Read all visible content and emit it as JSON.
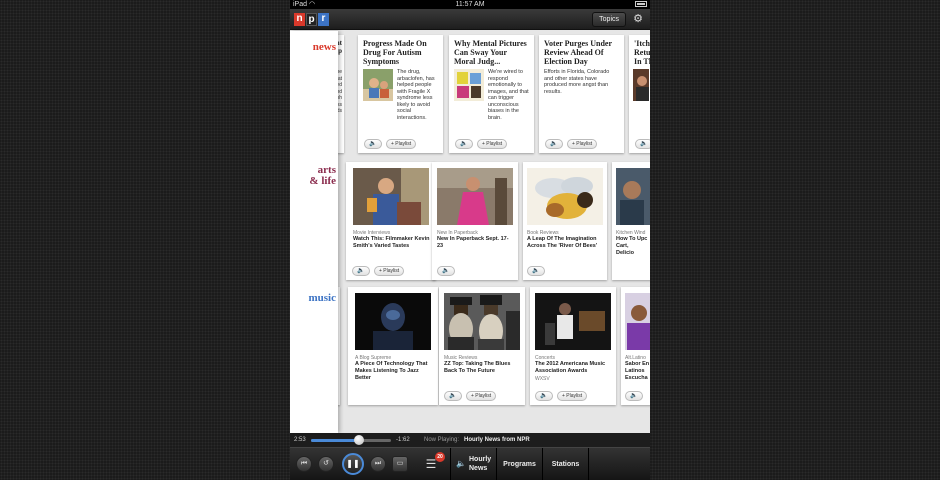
{
  "status_bar": {
    "carrier": "iPad",
    "time": "11:57 AM"
  },
  "nav": {
    "logo_letters": [
      "n",
      "p",
      "r"
    ],
    "topics_label": "Topics"
  },
  "sections": {
    "news": {
      "label": "news",
      "color": "#d9392b",
      "partial_left_lines": [
        "ent",
        "Rop",
        "",
        "n the",
        "that",
        "cted",
        "nd",
        "mph",
        "ness",
        "ds"
      ],
      "stories": [
        {
          "headline": "Progress Made On Drug For Autism Symptoms",
          "body": "The drug, arbaclofen, has helped people with Fragile X syndrome less likely to avoid social interactions.",
          "playlist": "+ Playlist"
        },
        {
          "headline": "Why Mental Pictures Can Sway Your Moral Judg...",
          "body": "We're wired to respond emotionally to images, and that can trigger unconscious biases in the brain.",
          "playlist": "+ Playlist"
        },
        {
          "headline": "Voter Purges Under Review Ahead Of Election Day",
          "body": "Efforts in Florida, Colorado and other states have produced more angst than results.",
          "playlist": "+ Playlist"
        },
        {
          "headline": "'Itch Retu In Th",
          "body": "",
          "playlist": ""
        }
      ]
    },
    "arts": {
      "label_line1": "arts",
      "label_line2": "& life",
      "color": "#8a2a4c",
      "stories": [
        {
          "section": "Movie Interviews",
          "title": "Watch This: Filmmaker Kevin Smith's Varied Tastes",
          "playlist": "+ Playlist"
        },
        {
          "section": "New In Paperback",
          "title": "New In Paperback Sept. 17-23",
          "playlist": ""
        },
        {
          "section": "Book Reviews",
          "title": "A Leap Of The Imagination Across The 'River Of Bees'",
          "playlist": ""
        },
        {
          "section": "Kitchen Wind",
          "title": "How To Upc Cart, Delicio",
          "playlist": ""
        }
      ]
    },
    "music": {
      "label": "music",
      "color": "#3c73c4",
      "stories": [
        {
          "section": "A Blog Supreme",
          "title": "A Piece Of Technology That Makes Listening To Jazz Better",
          "extra": "",
          "playlist": ""
        },
        {
          "section": "Music Reviews",
          "title": "ZZ Top: Taking The Blues Back To The Future",
          "extra": "",
          "playlist": "+ Playlist"
        },
        {
          "section": "Concerts",
          "title": "The 2012 Americana Music Association Awards",
          "extra": "WXSV",
          "playlist": "+ Playlist"
        },
        {
          "section": "Alt.Latino",
          "title": "Sabor En Latinos Escucha",
          "extra": "",
          "playlist": ""
        }
      ]
    }
  },
  "player": {
    "elapsed": "2:53",
    "remaining": "-1:62",
    "progress": 0.6,
    "now_playing_label": "Now Playing:",
    "now_playing_value": "Hourly News from NPR",
    "playlist_badge": "20",
    "accent": "#4a8ad8"
  },
  "tabs": {
    "hourly_line1": "Hourly",
    "hourly_line2": "News",
    "programs": "Programs",
    "stations": "Stations"
  }
}
